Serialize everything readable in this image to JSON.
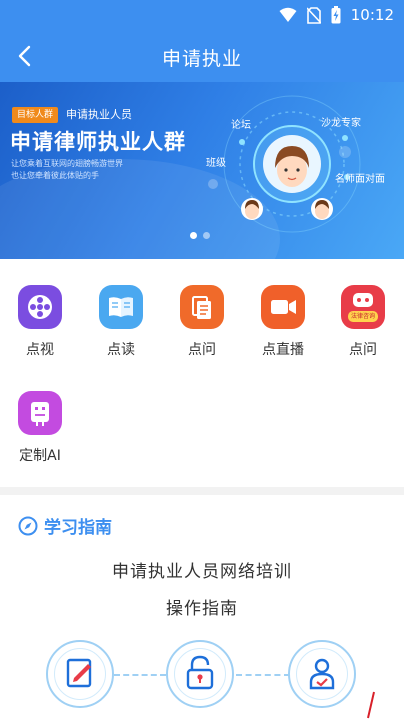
{
  "status_bar": {
    "time": "10:12",
    "icons": [
      "wifi-icon",
      "no-sim-icon",
      "battery-charging-icon"
    ]
  },
  "header": {
    "title": "申请执业",
    "back_icon": "back-arrow-icon"
  },
  "banner": {
    "tag": "目标人群",
    "subtitle": "申请执业人员",
    "title": "申请律师执业人群",
    "line1": "让您乘着互联网的翅膀畅游世界",
    "line2": "也让您牵着彼此体贴的手",
    "labels": {
      "forum": "论坛",
      "salon": "沙龙专家",
      "class": "班级",
      "face": "名师面对面"
    },
    "page_count": 2,
    "active_page": 1
  },
  "menu": [
    {
      "label": "点视",
      "icon": "film-reel-icon",
      "color": "#7b4de0"
    },
    {
      "label": "点读",
      "icon": "open-book-icon",
      "color": "#4aa8f0"
    },
    {
      "label": "点问",
      "icon": "document-stack-icon",
      "color": "#f06a2a"
    },
    {
      "label": "点直播",
      "icon": "video-camera-icon",
      "color": "#f0602a"
    },
    {
      "label": "点问",
      "icon": "robot-law-consult-icon",
      "color": "#e83c48",
      "badge": "法律咨询"
    },
    {
      "label": "定制AI",
      "icon": "ai-robot-icon",
      "color": "#c34be0"
    }
  ],
  "guide": {
    "title": "学习指南",
    "heading_line1": "申请执业人员网络培训",
    "heading_line2": "操作指南",
    "steps": [
      {
        "icon": "edit-form-icon"
      },
      {
        "icon": "unlock-icon"
      },
      {
        "icon": "user-verified-icon"
      }
    ]
  },
  "colors": {
    "primary": "#3d8ff0",
    "accent": "#f08a1c",
    "text": "#333333",
    "light_blue": "#9fd0f4"
  }
}
